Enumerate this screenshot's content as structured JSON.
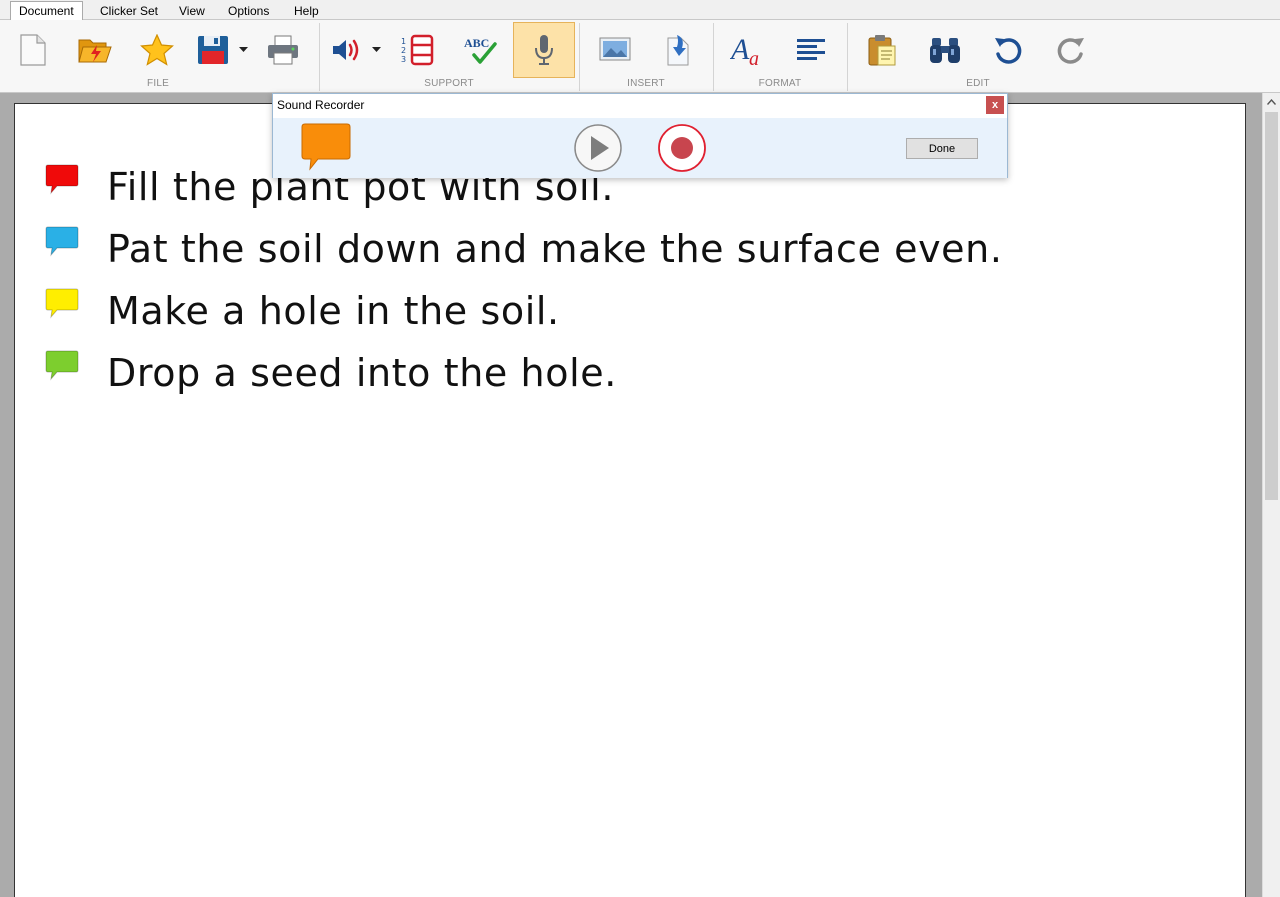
{
  "menu": {
    "tabs": [
      "Document",
      "Clicker Set",
      "View",
      "Options",
      "Help"
    ],
    "active_tab": "Document"
  },
  "ribbon": {
    "groups": [
      "FILE",
      "SUPPORT",
      "INSERT",
      "FORMAT",
      "EDIT"
    ],
    "buttons": [
      {
        "icon": "new-document-icon",
        "group": "FILE"
      },
      {
        "icon": "open-folder-icon",
        "group": "FILE"
      },
      {
        "icon": "favorite-star-icon",
        "group": "FILE"
      },
      {
        "icon": "save-disk-icon",
        "group": "FILE",
        "dropdown": true
      },
      {
        "icon": "print-icon",
        "group": "FILE"
      },
      {
        "icon": "speaker-icon",
        "group": "SUPPORT",
        "dropdown": true
      },
      {
        "icon": "numbered-list-icon",
        "group": "SUPPORT"
      },
      {
        "icon": "spellcheck-icon",
        "group": "SUPPORT"
      },
      {
        "icon": "microphone-icon",
        "group": "SUPPORT",
        "pressed": true
      },
      {
        "icon": "picture-icon",
        "group": "INSERT"
      },
      {
        "icon": "insert-file-icon",
        "group": "INSERT"
      },
      {
        "icon": "font-icon",
        "group": "FORMAT"
      },
      {
        "icon": "align-left-icon",
        "group": "FORMAT"
      },
      {
        "icon": "paste-clipboard-icon",
        "group": "EDIT"
      },
      {
        "icon": "find-binoculars-icon",
        "group": "EDIT"
      },
      {
        "icon": "undo-icon",
        "group": "EDIT"
      },
      {
        "icon": "redo-icon",
        "group": "EDIT"
      }
    ],
    "spellcheck_glyph": "ABC"
  },
  "dialog": {
    "title": "Sound Recorder",
    "close_label": "x",
    "done_label": "Done",
    "bubble_color": "#f98d0a"
  },
  "document": {
    "lines": [
      {
        "text": "Fill the plant pot with soil.",
        "bubble_color": "#f00a0a"
      },
      {
        "text": "Pat the soil down and make the surface even.",
        "bubble_color": "#2ab0e6"
      },
      {
        "text": "Make a hole in the soil.",
        "bubble_color": "#ffee00"
      },
      {
        "text": "Drop a seed into the hole.",
        "bubble_color": "#7dce2e"
      }
    ]
  }
}
